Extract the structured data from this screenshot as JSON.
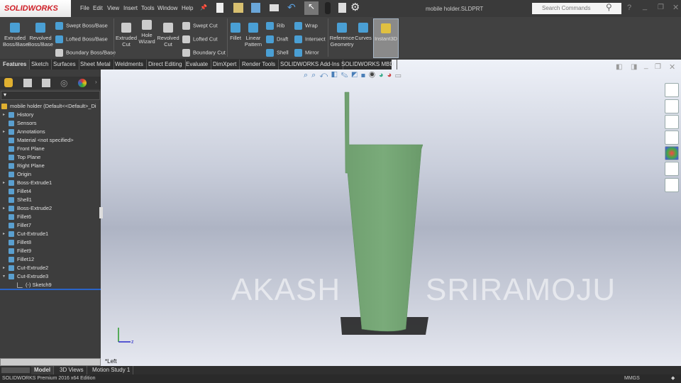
{
  "app": {
    "logo": "SOLIDWORKS",
    "doc_title": "mobile holder.SLDPRT",
    "search_placeholder": "Search Commands"
  },
  "menu": [
    "File",
    "Edit",
    "View",
    "Insert",
    "Tools",
    "Window",
    "Help"
  ],
  "ribbon": {
    "large": [
      {
        "label": "Extruded Boss/Base"
      },
      {
        "label": "Revolved Boss/Base"
      },
      {
        "label": "Extruded Cut"
      },
      {
        "label": "Hole Wizard"
      },
      {
        "label": "Revolved Cut"
      },
      {
        "label": "Fillet"
      },
      {
        "label": "Linear Pattern"
      },
      {
        "label": "Reference Geometry"
      },
      {
        "label": "Curves"
      },
      {
        "label": "Instant3D"
      }
    ],
    "small": [
      "Swept Boss/Base",
      "Lofted Boss/Base",
      "Boundary Boss/Base",
      "Swept Cut",
      "Lofted Cut",
      "Boundary Cut",
      "Rib",
      "Draft",
      "Shell",
      "Wrap",
      "Intersect",
      "Mirror"
    ]
  },
  "tabs": [
    "Features",
    "Sketch",
    "Surfaces",
    "Sheet Metal",
    "Weldments",
    "Direct Editing",
    "Evaluate",
    "DimXpert",
    "Render Tools",
    "SOLIDWORKS Add-Ins",
    "SOLIDWORKS MBD"
  ],
  "tree": {
    "root": "mobile holder  (Default<<Default>_Di",
    "items": [
      {
        "label": "History",
        "arrow": "▸"
      },
      {
        "label": "Sensors",
        "arrow": ""
      },
      {
        "label": "Annotations",
        "arrow": "▸"
      },
      {
        "label": "Material <not specified>",
        "arrow": ""
      },
      {
        "label": "Front Plane",
        "arrow": ""
      },
      {
        "label": "Top Plane",
        "arrow": ""
      },
      {
        "label": "Right Plane",
        "arrow": ""
      },
      {
        "label": "Origin",
        "arrow": ""
      },
      {
        "label": "Boss-Extrude1",
        "arrow": "▸"
      },
      {
        "label": "Fillet4",
        "arrow": ""
      },
      {
        "label": "Shell1",
        "arrow": ""
      },
      {
        "label": "Boss-Extrude2",
        "arrow": "▸"
      },
      {
        "label": "Fillet6",
        "arrow": ""
      },
      {
        "label": "Fillet7",
        "arrow": ""
      },
      {
        "label": "Cut-Extrude1",
        "arrow": "▸"
      },
      {
        "label": "Fillet8",
        "arrow": ""
      },
      {
        "label": "Fillet9",
        "arrow": ""
      },
      {
        "label": "Fillet12",
        "arrow": ""
      },
      {
        "label": "Cut-Extrude2",
        "arrow": "▸"
      },
      {
        "label": "Cut-Extrude3",
        "arrow": "▾"
      }
    ],
    "child": "(-) Sketch9"
  },
  "viewport": {
    "view_label": "*Left",
    "watermark_left": "AKASH",
    "watermark_right": "SRIRAMOJU",
    "model_color": "#78a878"
  },
  "bottom_tabs": [
    "Model",
    "3D Views",
    "Motion Study 1"
  ],
  "status": {
    "edition": "SOLIDWORKS Premium 2016 x64 Edition",
    "units": "MMGS"
  }
}
